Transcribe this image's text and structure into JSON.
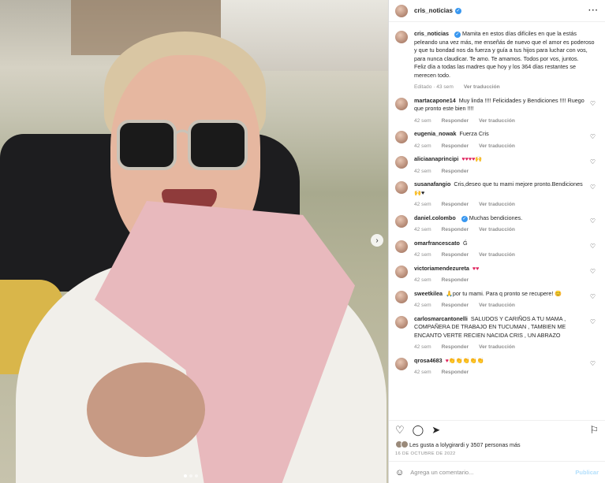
{
  "header": {
    "username": "cris_noticias",
    "more_icon": "more-horizontal-icon"
  },
  "caption": {
    "author": "cris_noticias",
    "text": "Mamita en estos días difíciles en que la estás peleando una vez más, me enseñás de nuevo que el amor es poderoso y que tu bondad nos da fuerza y guía a tus hijos para luchar con vos, para nunca claudicar. Te amo. Te amamos. Todos por vos, juntos.",
    "text2": "Feliz día a todas las madres que hoy y los 364 días restantes se merecen todo.",
    "edited": "Editado · 43 sem",
    "translate": "Ver traducción"
  },
  "comments": [
    {
      "author": "martacapone14",
      "text": "Muy linda !!!! Felicidades y Bendiciones !!!! Ruego que pronto este bien !!!!",
      "time": "42 sem",
      "reply": "Responder",
      "translate": "Ver traducción"
    },
    {
      "author": "eugenia_nowak",
      "text": "Fuerza Cris",
      "time": "42 sem",
      "reply": "Responder",
      "translate": "Ver traducción"
    },
    {
      "author": "aliciaanaprincipi",
      "text": "♥♥♥♥🙌",
      "time": "42 sem",
      "reply": "Responder",
      "translate": ""
    },
    {
      "author": "susanafangio",
      "text": "Cris,deseo que tu mami mejore pronto.Bendiciones🙌♥",
      "time": "42 sem",
      "reply": "Responder",
      "translate": "Ver traducción"
    },
    {
      "author": "daniel.colombo",
      "text": "Muchas bendiciones.",
      "time": "42 sem",
      "reply": "Responder",
      "translate": "Ver traducción"
    },
    {
      "author": "omarfrancescato",
      "text": "Ǵ",
      "time": "42 sem",
      "reply": "Responder",
      "translate": "Ver traducción"
    },
    {
      "author": "victoriamendezureta",
      "text": "♥♥",
      "time": "42 sem",
      "reply": "Responder",
      "translate": ""
    },
    {
      "author": "sweetkilea",
      "text": "🙏por tu mami. Para q pronto se recupere! 😊",
      "time": "42 sem",
      "reply": "Responder",
      "translate": "Ver traducción"
    },
    {
      "author": "carlosmarcantonelli",
      "text": "SALUDOS Y CARIÑOS A TU MAMA , COMPAÑERA DE TRABAJO EN TUCUMAN , TAMBIEN ME ENCANTO VERTE RECIEN NACIDA CRIS , UN ABRAZO",
      "time": "42 sem",
      "reply": "Responder",
      "translate": "Ver traducción"
    },
    {
      "author": "qrosa4683",
      "text": "♥👏👏👏👏👏",
      "time": "42 sem",
      "reply": "Responder",
      "translate": ""
    }
  ],
  "likes": {
    "text": "Les gusta a lolygirardi y 3507 personas más"
  },
  "date": "16 DE OCTUBRE DE 2022",
  "add_comment": {
    "placeholder": "Agrega un comentario...",
    "publish": "Publicar"
  }
}
